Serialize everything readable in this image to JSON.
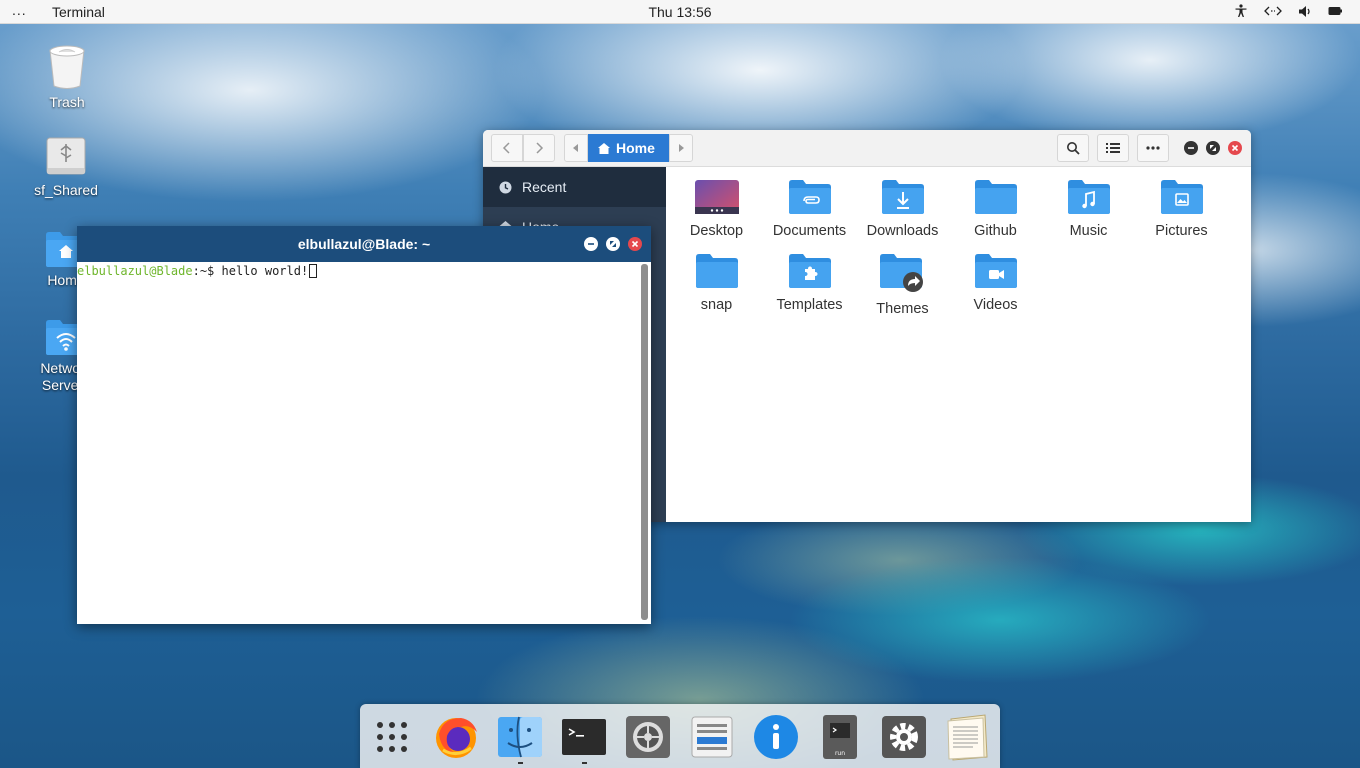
{
  "topbar": {
    "menu_dots": "...",
    "app_name": "Terminal",
    "clock": "Thu 13:56",
    "indicators": [
      "accessibility-icon",
      "network-icon",
      "volume-icon",
      "battery-icon"
    ]
  },
  "desktop": {
    "icons": [
      {
        "label": "Trash",
        "icon": "trash-icon"
      },
      {
        "label": "sf_Shared",
        "icon": "usb-drive-icon"
      },
      {
        "label": "Home",
        "icon": "home-folder-icon"
      },
      {
        "label": "Network Servers",
        "icon": "network-folder-icon"
      }
    ]
  },
  "file_manager": {
    "location": "Home",
    "sidebar": [
      {
        "label": "Recent",
        "icon": "clock-icon"
      },
      {
        "label": "Home",
        "icon": "home-icon"
      }
    ],
    "folders": [
      {
        "label": "Desktop",
        "icon": "desktop-folder-icon"
      },
      {
        "label": "Documents",
        "icon": "documents-folder-icon"
      },
      {
        "label": "Downloads",
        "icon": "downloads-folder-icon"
      },
      {
        "label": "Github",
        "icon": "folder-icon"
      },
      {
        "label": "Music",
        "icon": "music-folder-icon"
      },
      {
        "label": "Pictures",
        "icon": "pictures-folder-icon"
      },
      {
        "label": "snap",
        "icon": "folder-icon"
      },
      {
        "label": "Templates",
        "icon": "templates-folder-icon"
      },
      {
        "label": "Themes",
        "icon": "symlink-folder-icon"
      },
      {
        "label": "Videos",
        "icon": "videos-folder-icon"
      }
    ]
  },
  "terminal": {
    "title": "elbullazul@Blade: ~",
    "prompt_user": "elbullazul@Blade",
    "prompt_path": ":~$ ",
    "command": "hello world!"
  },
  "dock": {
    "items": [
      {
        "icon": "app-grid-icon"
      },
      {
        "icon": "firefox-icon"
      },
      {
        "icon": "file-manager-icon"
      },
      {
        "icon": "terminal-icon"
      },
      {
        "icon": "system-settings-icon"
      },
      {
        "icon": "software-updater-icon"
      },
      {
        "icon": "info-icon"
      },
      {
        "icon": "run-command-icon",
        "label": "run"
      },
      {
        "icon": "settings-gear-icon"
      },
      {
        "icon": "text-editor-icon"
      }
    ]
  },
  "colors": {
    "accent": "#2b7ad3",
    "folder": "#3d9be9",
    "terminal_header": "#1c4d7c",
    "sidebar": "#2d3e53",
    "prompt_user": "#6fb62c"
  }
}
